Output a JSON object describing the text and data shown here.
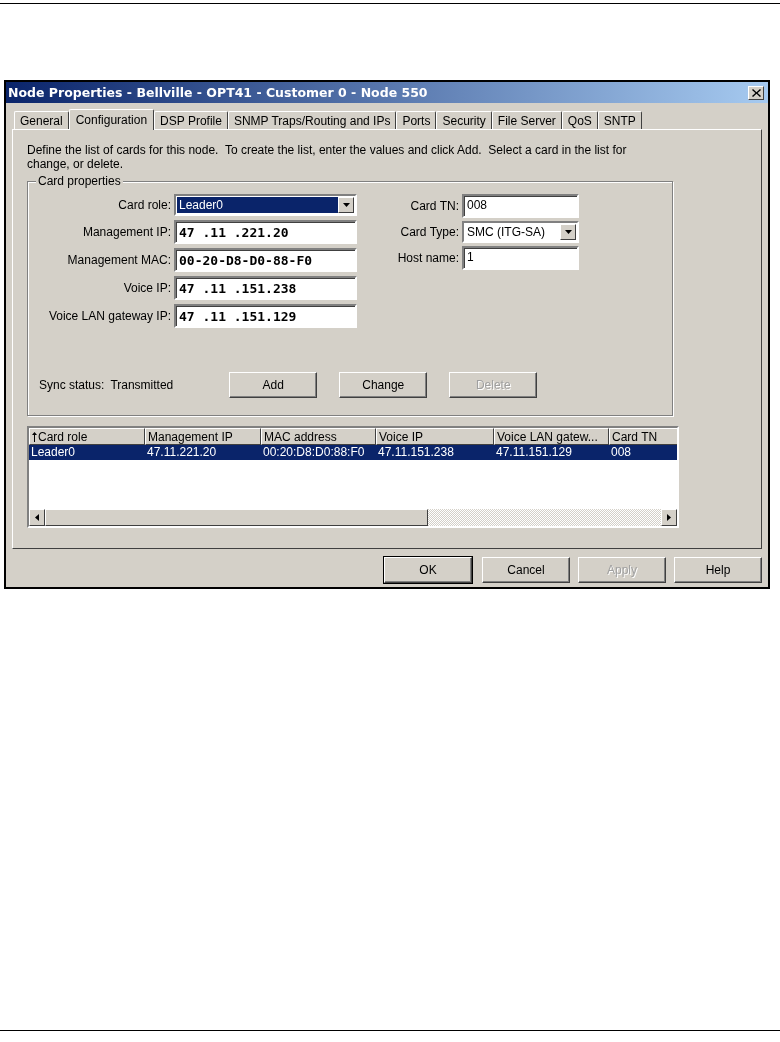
{
  "window": {
    "title": "Node Properties - Bellville - OPT41 - Customer 0 - Node 550"
  },
  "tabs": [
    {
      "label": "General",
      "selected": false
    },
    {
      "label": "Configuration",
      "selected": true
    },
    {
      "label": "DSP Profile",
      "selected": false
    },
    {
      "label": "SNMP Traps/Routing and IPs",
      "selected": false
    },
    {
      "label": "Ports",
      "selected": false
    },
    {
      "label": "Security",
      "selected": false
    },
    {
      "label": "File Server",
      "selected": false
    },
    {
      "label": "QoS",
      "selected": false
    },
    {
      "label": "SNTP",
      "selected": false
    }
  ],
  "description": "Define the list of cards for this node.  To create the list, enter the values and click Add.  Select a card in the list for change, or delete.",
  "card_properties": {
    "title": "Card properties",
    "left_fields": [
      {
        "label": "Card role:",
        "value": "Leader0",
        "kind": "dropdown",
        "focused": true
      },
      {
        "label": "Management IP:",
        "value": "47 .11 .221.20",
        "kind": "ip",
        "focused": false
      },
      {
        "label": "Management MAC:",
        "value": "00-20-D8-D0-88-F0",
        "kind": "ip",
        "focused": false
      },
      {
        "label": "Voice IP:",
        "value": "47 .11 .151.238",
        "kind": "ip",
        "focused": false
      },
      {
        "label": "Voice LAN gateway IP:",
        "value": "47 .11 .151.129",
        "kind": "ip",
        "focused": false
      }
    ],
    "right_fields": [
      {
        "label": "Card TN:",
        "value": "008",
        "kind": "text",
        "focused": false
      },
      {
        "label": "Card Type:",
        "value": "SMC (ITG-SA)",
        "kind": "dropdown",
        "focused": false
      },
      {
        "label": "Host name:",
        "value": "1",
        "kind": "text",
        "focused": false
      }
    ],
    "sync_status_label": "Sync status:",
    "sync_status": "Transmitted",
    "buttons": [
      {
        "label": "Add",
        "disabled": false
      },
      {
        "label": "Change",
        "disabled": false
      },
      {
        "label": "Delete",
        "disabled": true
      }
    ]
  },
  "table": {
    "columns": [
      {
        "label": "Card role",
        "sorted": true
      },
      {
        "label": "Management IP",
        "sorted": false
      },
      {
        "label": "MAC address",
        "sorted": false
      },
      {
        "label": "Voice IP",
        "sorted": false
      },
      {
        "label": "Voice LAN gatew...",
        "sorted": false
      },
      {
        "label": "Card TN",
        "sorted": false
      }
    ],
    "rows": [
      {
        "cells": [
          "Leader0",
          "47.11.221.20",
          "00:20:D8:D0:88:F0",
          "47.11.151.238",
          "47.11.151.129",
          "008"
        ],
        "selected": true
      }
    ]
  },
  "buttons": [
    {
      "label": "OK",
      "disabled": false
    },
    {
      "label": "Cancel",
      "disabled": false
    },
    {
      "label": "Apply",
      "disabled": true
    },
    {
      "label": "Help",
      "disabled": false
    }
  ]
}
